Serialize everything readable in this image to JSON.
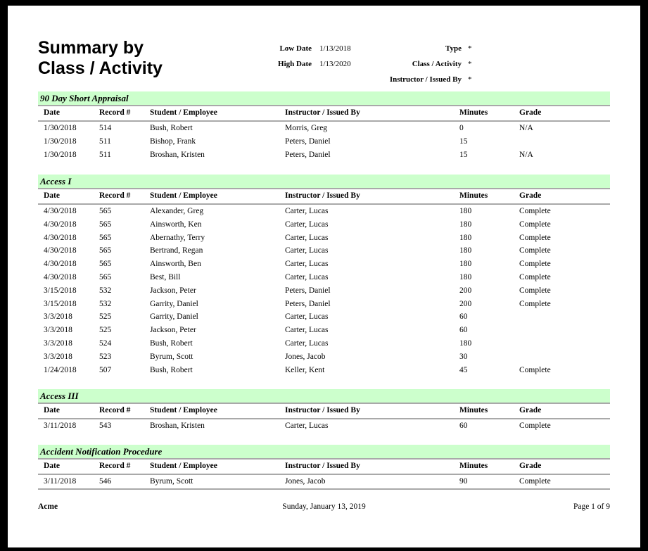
{
  "report": {
    "title_line1": "Summary by",
    "title_line2": "Class / Activity",
    "parameters_left": [
      {
        "label": "Low Date",
        "value": "1/13/2018"
      },
      {
        "label": "High Date",
        "value": "1/13/2020"
      }
    ],
    "parameters_right": [
      {
        "label": "Type",
        "value": "*"
      },
      {
        "label": "Class / Activity",
        "value": "*"
      },
      {
        "label": "Instructor / Issued By",
        "value": "*"
      }
    ],
    "columns": [
      "Date",
      "Record #",
      "Student / Employee",
      "Instructor / Issued By",
      "Minutes",
      "Grade"
    ],
    "band_color": "#ccffcc",
    "rule_color": "#a9a9a9",
    "groups": [
      {
        "name": "90 Day Short Appraisal",
        "rows": [
          {
            "date": "1/30/2018",
            "record": "514",
            "student": "Bush, Robert",
            "instructor": "Morris, Greg",
            "minutes": "0",
            "grade": "N/A"
          },
          {
            "date": "1/30/2018",
            "record": "511",
            "student": "Bishop, Frank",
            "instructor": "Peters, Daniel",
            "minutes": "15",
            "grade": ""
          },
          {
            "date": "1/30/2018",
            "record": "511",
            "student": "Broshan, Kristen",
            "instructor": "Peters, Daniel",
            "minutes": "15",
            "grade": "N/A"
          }
        ]
      },
      {
        "name": "Access I",
        "rows": [
          {
            "date": "4/30/2018",
            "record": "565",
            "student": "Alexander, Greg",
            "instructor": "Carter, Lucas",
            "minutes": "180",
            "grade": "Complete"
          },
          {
            "date": "4/30/2018",
            "record": "565",
            "student": "Ainsworth, Ken",
            "instructor": "Carter, Lucas",
            "minutes": "180",
            "grade": "Complete"
          },
          {
            "date": "4/30/2018",
            "record": "565",
            "student": "Abernathy, Terry",
            "instructor": "Carter, Lucas",
            "minutes": "180",
            "grade": "Complete"
          },
          {
            "date": "4/30/2018",
            "record": "565",
            "student": "Bertrand, Regan",
            "instructor": "Carter, Lucas",
            "minutes": "180",
            "grade": "Complete"
          },
          {
            "date": "4/30/2018",
            "record": "565",
            "student": "Ainsworth, Ben",
            "instructor": "Carter, Lucas",
            "minutes": "180",
            "grade": "Complete"
          },
          {
            "date": "4/30/2018",
            "record": "565",
            "student": "Best, Bill",
            "instructor": "Carter, Lucas",
            "minutes": "180",
            "grade": "Complete"
          },
          {
            "date": "3/15/2018",
            "record": "532",
            "student": "Jackson, Peter",
            "instructor": "Peters, Daniel",
            "minutes": "200",
            "grade": "Complete"
          },
          {
            "date": "3/15/2018",
            "record": "532",
            "student": "Garrity, Daniel",
            "instructor": "Peters, Daniel",
            "minutes": "200",
            "grade": "Complete"
          },
          {
            "date": "3/3/2018",
            "record": "525",
            "student": "Garrity, Daniel",
            "instructor": "Carter, Lucas",
            "minutes": "60",
            "grade": ""
          },
          {
            "date": "3/3/2018",
            "record": "525",
            "student": "Jackson, Peter",
            "instructor": "Carter, Lucas",
            "minutes": "60",
            "grade": ""
          },
          {
            "date": "3/3/2018",
            "record": "524",
            "student": "Bush, Robert",
            "instructor": "Carter, Lucas",
            "minutes": "180",
            "grade": ""
          },
          {
            "date": "3/3/2018",
            "record": "523",
            "student": "Byrum, Scott",
            "instructor": "Jones, Jacob",
            "minutes": "30",
            "grade": ""
          },
          {
            "date": "1/24/2018",
            "record": "507",
            "student": "Bush, Robert",
            "instructor": "Keller, Kent",
            "minutes": "45",
            "grade": "Complete"
          }
        ]
      },
      {
        "name": "Access III",
        "rows": [
          {
            "date": "3/11/2018",
            "record": "543",
            "student": "Broshan, Kristen",
            "instructor": "Carter, Lucas",
            "minutes": "60",
            "grade": "Complete"
          }
        ]
      },
      {
        "name": "Accident Notification Procedure",
        "rows": [
          {
            "date": "3/11/2018",
            "record": "546",
            "student": "Byrum, Scott",
            "instructor": "Jones, Jacob",
            "minutes": "90",
            "grade": "Complete"
          }
        ]
      }
    ]
  },
  "footer": {
    "company": "Acme",
    "date": "Sunday, January 13, 2019",
    "page": "Page 1 of 9"
  }
}
